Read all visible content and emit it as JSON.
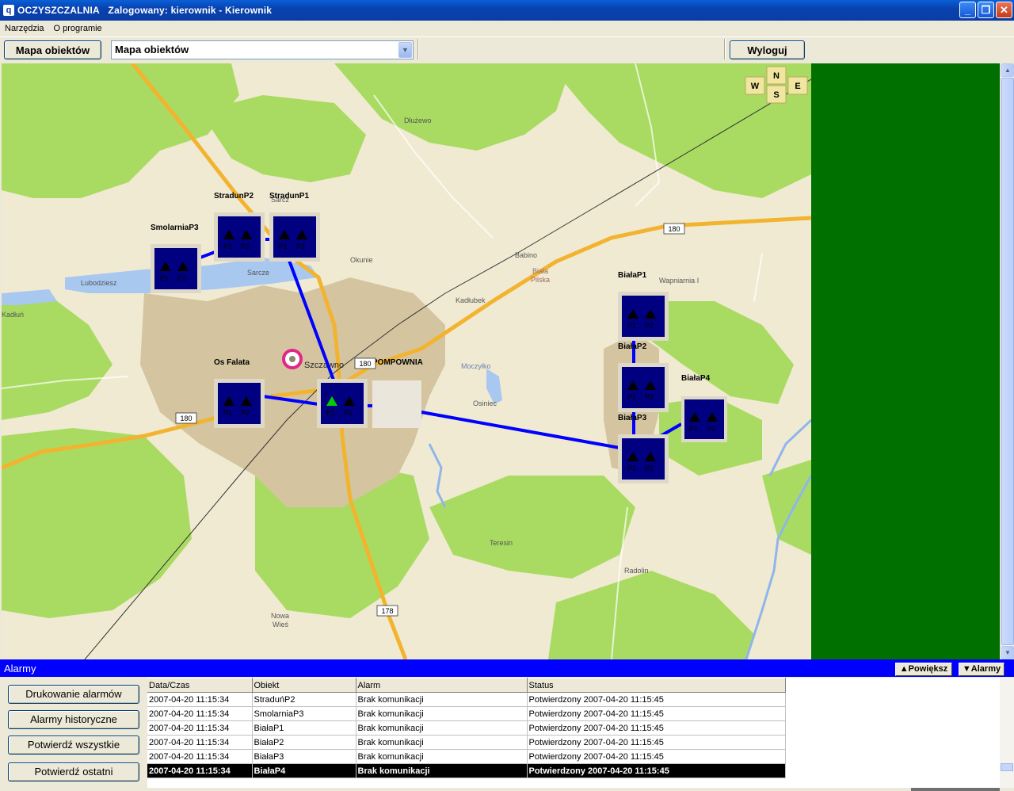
{
  "window": {
    "app_name": "OCZYSZCZALNIA",
    "user_info": "Zalogowany: kierownik - Kierownik",
    "min_glyph": "_",
    "restore_glyph": "❐",
    "close_glyph": "✕"
  },
  "menu": [
    "Narzędzia",
    "O programie"
  ],
  "toolbar": {
    "map_button": "Mapa obiektów",
    "view_select_value": "Mapa obiektów",
    "logout_button": "Wyloguj"
  },
  "compass": {
    "w": "W",
    "n": "N",
    "s": "S",
    "e": "E"
  },
  "map": {
    "places": [
      "Dłużewo",
      "Sarcz",
      "Okunie",
      "Sarcze",
      "Lubodziesz",
      "Babino",
      "Biała",
      "Pilska",
      "Kadłubek",
      "Wapniarnia I",
      "Moczyłko",
      "Osiniec",
      "Teresin",
      "Radolin",
      "Nowa",
      "Wieś",
      "Kadłuń",
      "Szczawno",
      "POMPOWNIA"
    ],
    "roads": [
      "180",
      "180",
      "180",
      "178"
    ],
    "stations": [
      {
        "name": "StradunP2",
        "p1": "P1",
        "p2": "P2"
      },
      {
        "name": "StradunP1",
        "p1": "P1",
        "p2": "P2"
      },
      {
        "name": "SmolarniaP3",
        "p1": "P1",
        "p2": "P2"
      },
      {
        "name": "Os Falata",
        "p1": "P1",
        "p2": "P2"
      },
      {
        "name": "Szczawno",
        "p1": "P1",
        "p2": "P2"
      },
      {
        "name": "BiałaP1",
        "p1": "P1",
        "p2": "P2"
      },
      {
        "name": "BiałaP2",
        "p1": "P1",
        "p2": "P2"
      },
      {
        "name": "BiałaP3",
        "p1": "P1",
        "p2": "P2"
      },
      {
        "name": "BiałaP4",
        "p1": "P1",
        "p2": "P2"
      }
    ]
  },
  "alarms": {
    "title": "Alarmy",
    "zoom_button": "▲Powiększ",
    "alarms_button": "▼Alarmy",
    "buttons": [
      "Drukowanie alarmów",
      "Alarmy historyczne",
      "Potwierdź wszystkie",
      "Potwierdź ostatni"
    ],
    "columns": [
      "Data/Czas",
      "Obiekt",
      "Alarm",
      "Status"
    ],
    "rows": [
      [
        "2007-04-20 11:15:34",
        "StraduńP2",
        "Brak komunikacji",
        "Potwierdzony 2007-04-20 11:15:45"
      ],
      [
        "2007-04-20 11:15:34",
        "SmolarniaP3",
        "Brak komunikacji",
        "Potwierdzony 2007-04-20 11:15:45"
      ],
      [
        "2007-04-20 11:15:34",
        "BiałaP1",
        "Brak komunikacji",
        "Potwierdzony 2007-04-20 11:15:45"
      ],
      [
        "2007-04-20 11:15:34",
        "BiałaP2",
        "Brak komunikacji",
        "Potwierdzony 2007-04-20 11:15:45"
      ],
      [
        "2007-04-20 11:15:34",
        "BiałaP3",
        "Brak komunikacji",
        "Potwierdzony 2007-04-20 11:15:45"
      ],
      [
        "2007-04-20 11:15:34",
        "BiałaP4",
        "Brak komunikacji",
        "Potwierdzony 2007-04-20 11:15:45"
      ]
    ]
  },
  "colors": {
    "station_fill": "#000080",
    "pipe": "#0000ff",
    "alarm_bar": "#0000ff",
    "right_panel": "#007000",
    "pump_active": "#00d000"
  }
}
